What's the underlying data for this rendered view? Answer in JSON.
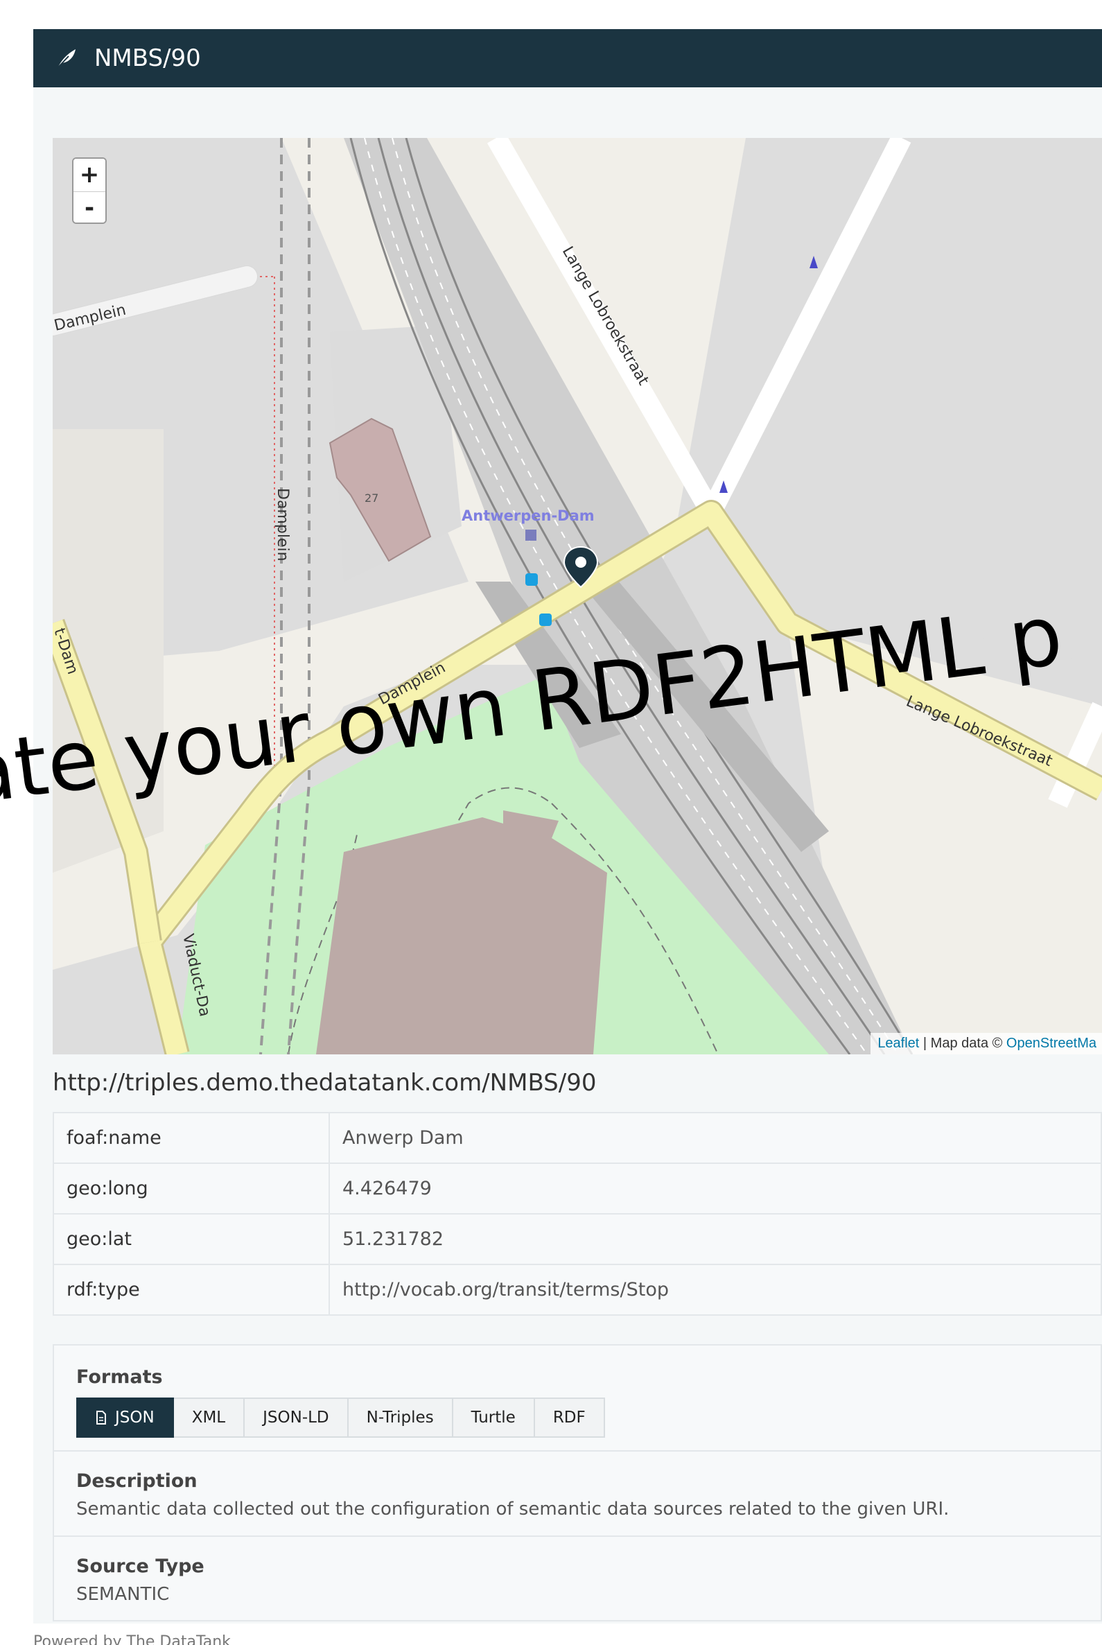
{
  "header": {
    "title": "NMBS/90",
    "icon": "feather-icon"
  },
  "map": {
    "zoom_in": "+",
    "zoom_out": "-",
    "labels": {
      "damplein_1": "Damplein",
      "damplein_2": "Damplein",
      "damplein_3": "Damplein",
      "lange_1": "Lange Lobroekstraat",
      "lange_2": "Lange Lobroekstraat",
      "dam_left": "t-Dam",
      "viaduct": "Viaduct-Da",
      "station": "Antwerpen-Dam",
      "building_no": "27"
    },
    "attribution": {
      "leaflet": "Leaflet",
      "sep": " | Map data © ",
      "osm": "OpenStreetMa"
    }
  },
  "watermark": "ate your own RDF2HTML p",
  "resource_uri": "http://triples.demo.thedatatank.com/NMBS/90",
  "properties": [
    {
      "key": "foaf:name",
      "value": "Anwerp Dam"
    },
    {
      "key": "geo:long",
      "value": "4.426479"
    },
    {
      "key": "geo:lat",
      "value": "51.231782"
    },
    {
      "key": "rdf:type",
      "value": "http://vocab.org/transit/terms/Stop"
    }
  ],
  "formats": {
    "title": "Formats",
    "items": [
      "JSON",
      "XML",
      "JSON-LD",
      "N-Triples",
      "Turtle",
      "RDF"
    ],
    "active": "JSON"
  },
  "description": {
    "title": "Description",
    "text": "Semantic data collected out the configuration of semantic data sources related to the given URI."
  },
  "source_type": {
    "title": "Source Type",
    "text": "SEMANTIC"
  },
  "footer": "Powered by The DataTank"
}
